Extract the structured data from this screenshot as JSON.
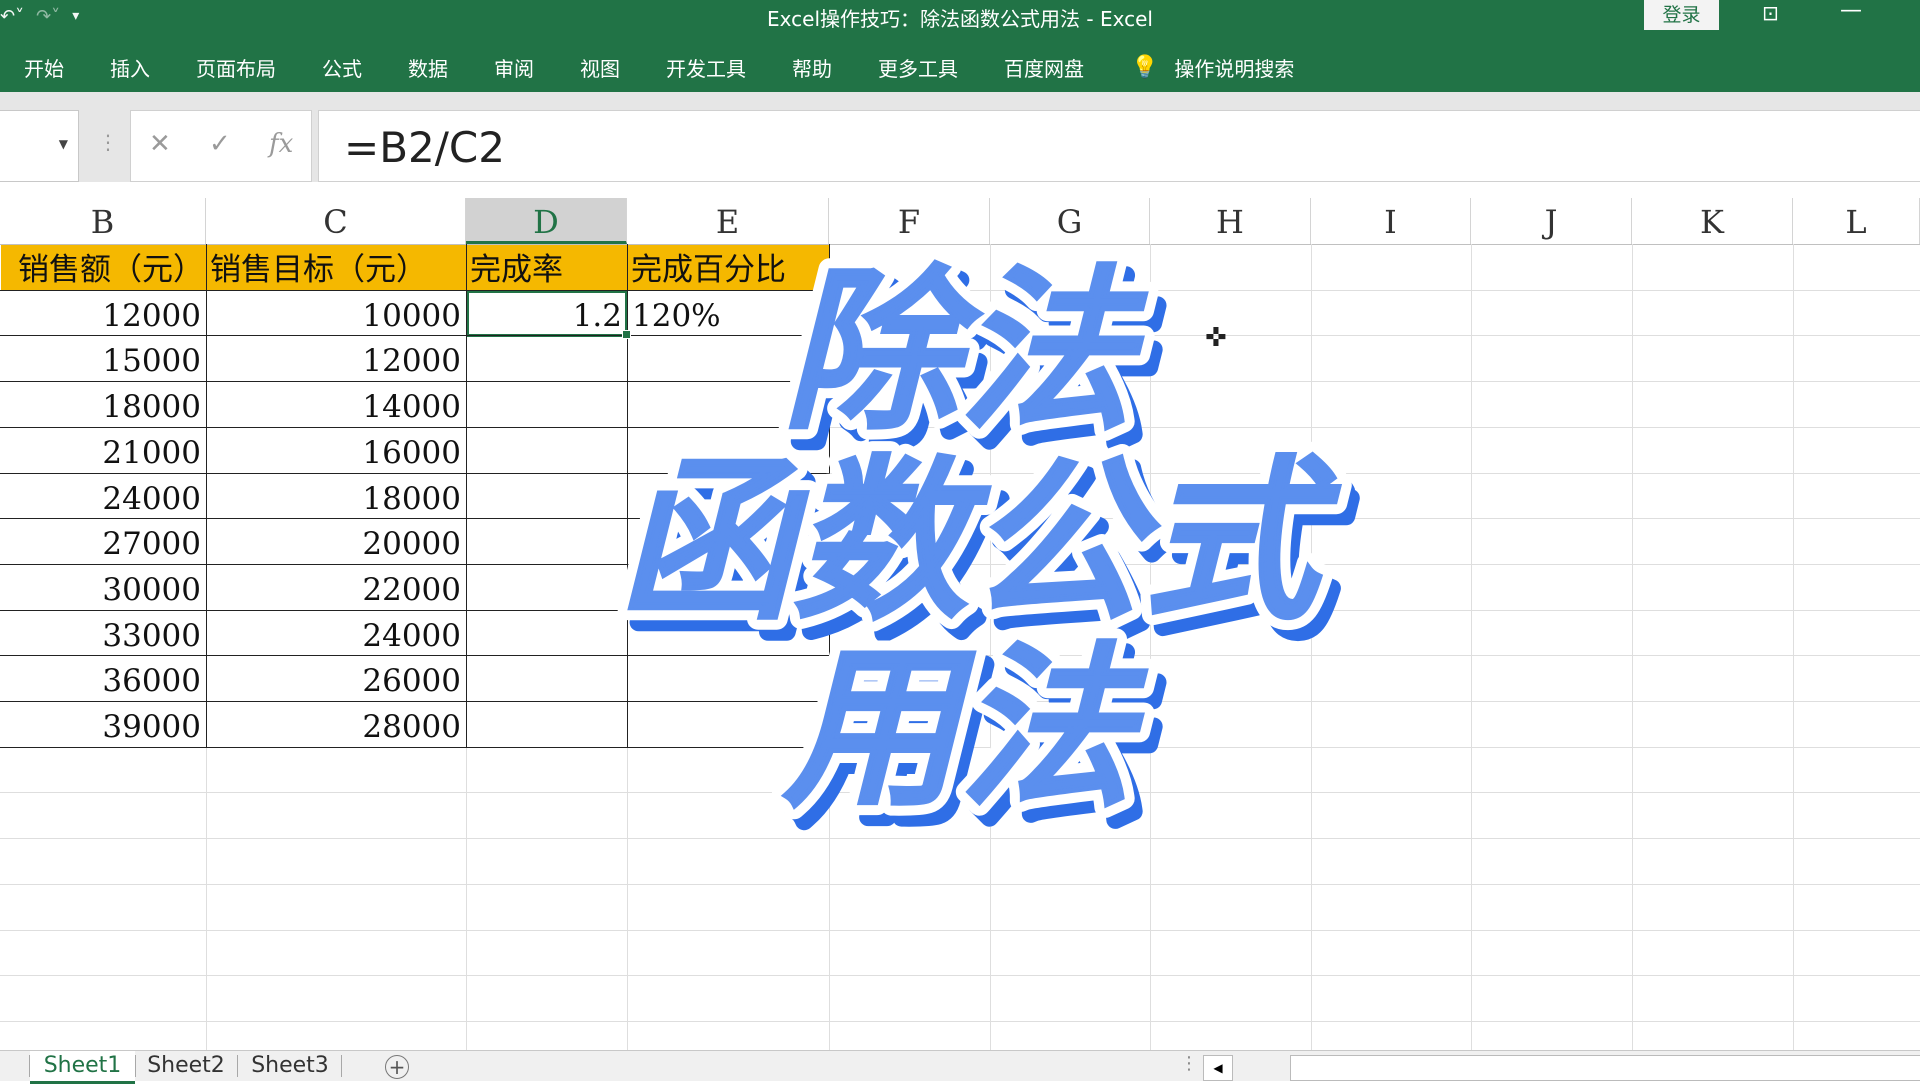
{
  "titlebar": {
    "qat_icons": [
      "undo-icon",
      "redo-icon",
      "customize-qat-icon"
    ],
    "title": "Excel操作技巧：除法函数公式用法  -  Excel",
    "login": "登录"
  },
  "ribbon": {
    "tabs": [
      "开始",
      "插入",
      "页面布局",
      "公式",
      "数据",
      "审阅",
      "视图",
      "开发工具",
      "帮助",
      "更多工具",
      "百度网盘"
    ],
    "search": "操作说明搜索"
  },
  "formula_bar": {
    "value": "=B2/C2"
  },
  "columns": [
    "B",
    "C",
    "D",
    "E",
    "F",
    "G",
    "H",
    "I",
    "J",
    "K",
    "L"
  ],
  "selected_column": "D",
  "table": {
    "headers": [
      "销售额（元）",
      "销售目标（元）",
      "完成率",
      "完成百分比"
    ],
    "rows": [
      [
        "12000",
        "10000",
        "1.2",
        "120%"
      ],
      [
        "15000",
        "12000",
        "",
        ""
      ],
      [
        "18000",
        "14000",
        "",
        ""
      ],
      [
        "21000",
        "16000",
        "",
        ""
      ],
      [
        "24000",
        "18000",
        "",
        ""
      ],
      [
        "27000",
        "20000",
        "",
        ""
      ],
      [
        "30000",
        "22000",
        "",
        ""
      ],
      [
        "33000",
        "24000",
        "",
        ""
      ],
      [
        "36000",
        "26000",
        "",
        ""
      ],
      [
        "39000",
        "28000",
        "",
        ""
      ]
    ]
  },
  "overlay": {
    "line1": "除法",
    "line2": "函数公式",
    "line3": "用法"
  },
  "sheets": [
    "Sheet1",
    "Sheet2",
    "Sheet3"
  ],
  "active_sheet": "Sheet1",
  "colors": {
    "excel_green": "#217346",
    "header_fill": "#f5b800",
    "overlay_fill": "#5b8fee",
    "overlay_shadow": "#2f6ee6"
  }
}
